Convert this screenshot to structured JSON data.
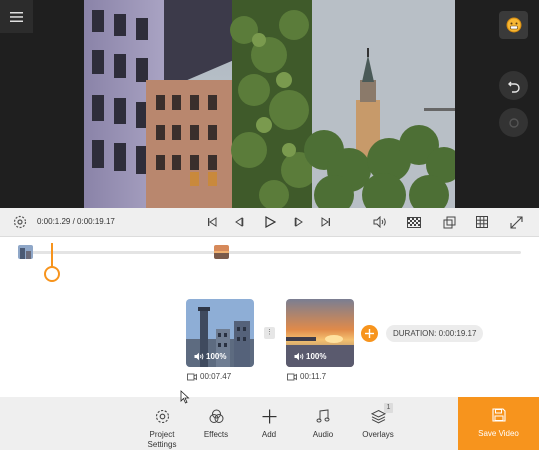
{
  "player": {
    "time_current": "0:00:1.29",
    "time_total": "0:00:19.17",
    "time_separator": " / "
  },
  "storyboard": {
    "clips": [
      {
        "volume": "100%",
        "duration": "00:07.47"
      },
      {
        "volume": "100%",
        "duration": "00:11.7"
      }
    ],
    "total_duration": "DURATION: 0:00:19.17"
  },
  "toolbar": {
    "project_settings_line1": "Project",
    "project_settings_line2": "Settings",
    "effects": "Effects",
    "add": "Add",
    "audio": "Audio",
    "overlays": "Overlays",
    "overlays_badge": "1",
    "save_video": "Save Video"
  },
  "colors": {
    "accent": "#f7941d",
    "toolbar_bg": "#efefef",
    "preview_bg": "#1f1f1f"
  },
  "icons": {
    "menu": "hamburger-icon",
    "emoji": "smiley-icon",
    "undo": "undo-icon",
    "settings": "gear-icon",
    "volume": "speaker-icon",
    "duration": "camera-icon"
  }
}
